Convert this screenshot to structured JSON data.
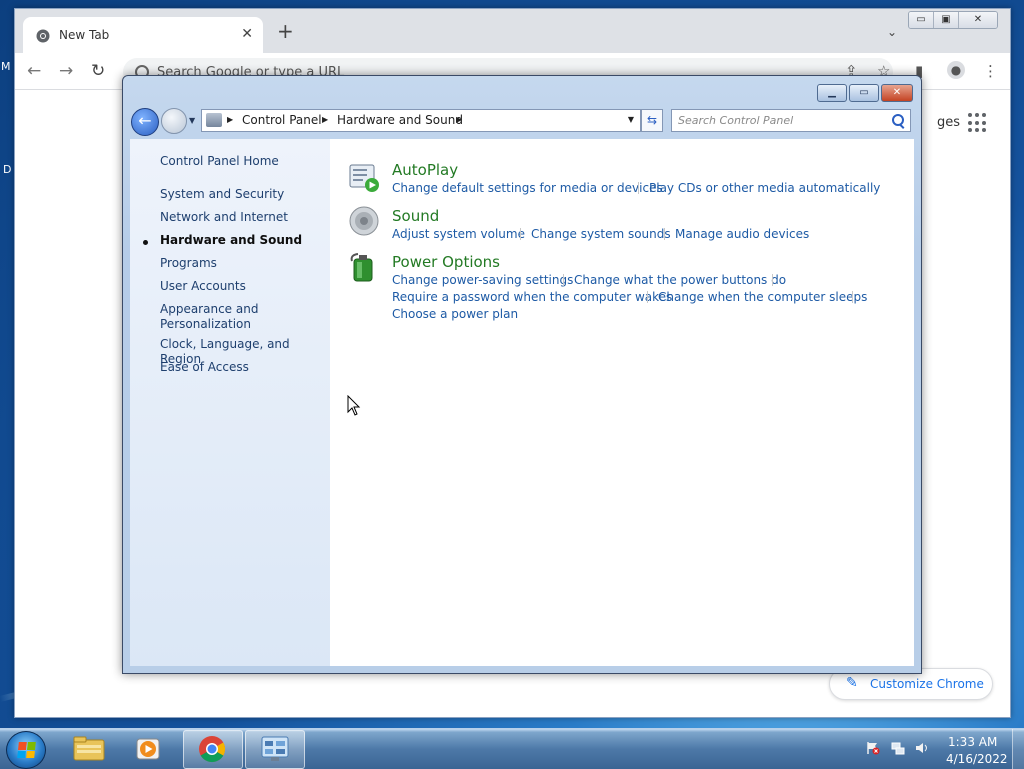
{
  "desktop": {
    "edge_text_1": "M",
    "edge_text_2": "D"
  },
  "chrome": {
    "tab_title": "New Tab",
    "tab_close": "✕",
    "new_tab": "+",
    "tab_dropdown": "⌄",
    "omnibox_placeholder": "Search Google or type a URL",
    "side_text": "ges",
    "customize_label": "Customize Chrome",
    "window_buttons": [
      "▭",
      "▣",
      "✕"
    ]
  },
  "control_panel": {
    "address_segments": [
      "Control Panel",
      "Hardware and Sound"
    ],
    "search_placeholder": "Search Control Panel",
    "caption_buttons": {
      "minimize": "▁",
      "maximize": "▭",
      "close": "✕"
    },
    "nav": {
      "home": "Control Panel Home",
      "items": [
        "System and Security",
        "Network and Internet",
        "Hardware and Sound",
        "Programs",
        "User Accounts",
        "Appearance and Personalization",
        "Clock, Language, and Region",
        "Ease of Access"
      ],
      "active_item": "Hardware and Sound"
    },
    "categories": [
      {
        "title": "AutoPlay",
        "icon": "autoplay-icon",
        "links": [
          "Change default settings for media or devices",
          "Play CDs or other media automatically"
        ]
      },
      {
        "title": "Sound",
        "icon": "speaker-icon",
        "links": [
          "Adjust system volume",
          "Change system sounds",
          "Manage audio devices"
        ]
      },
      {
        "title": "Power Options",
        "icon": "battery-icon",
        "links": [
          "Change power-saving settings",
          "Change what the power buttons do",
          "Require a password when the computer wakes",
          "Change when the computer sleeps",
          "Choose a power plan"
        ]
      }
    ]
  },
  "taskbar": {
    "apps": [
      "file-explorer-icon",
      "media-player-icon",
      "chrome-icon",
      "control-panel-icon"
    ],
    "active_app": "control-panel-icon",
    "clock_time": "1:33 AM",
    "clock_date": "4/16/2022"
  },
  "colors": {
    "link": "#1d5aa5",
    "category_title": "#237a24",
    "chrome_accent": "#1a73e8"
  }
}
